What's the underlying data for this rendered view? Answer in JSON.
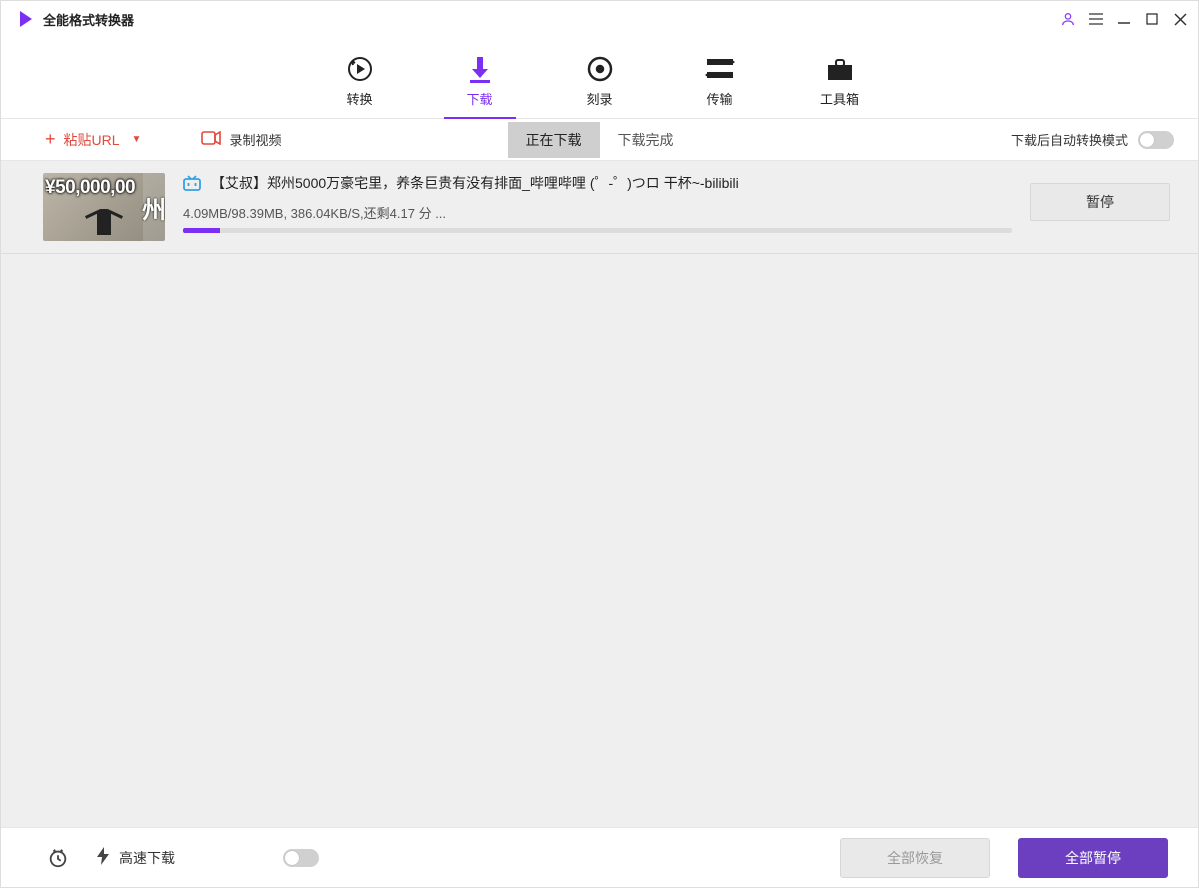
{
  "app": {
    "title": "全能格式转换器"
  },
  "nav": {
    "convert": "转换",
    "download": "下载",
    "burn": "刻录",
    "transfer": "传输",
    "toolbox": "工具箱"
  },
  "toolbar": {
    "paste_url": "粘贴URL",
    "record_video": "录制视频",
    "tab_downloading": "正在下载",
    "tab_completed": "下载完成",
    "auto_convert_label": "下载后自动转换模式"
  },
  "downloads": [
    {
      "title": "【艾叔】郑州5000万豪宅里，养条巨贵有没有排面_哔哩哔哩 (゜-゜)つロ 干杯~-bilibili",
      "stats": "4.09MB/98.39MB, 386.04KB/S,还剩4.17 分 ...",
      "progress_percent": 4.5,
      "pause_label": "暂停"
    }
  ],
  "bottom": {
    "fast_download": "高速下载",
    "resume_all": "全部恢复",
    "pause_all": "全部暂停"
  }
}
